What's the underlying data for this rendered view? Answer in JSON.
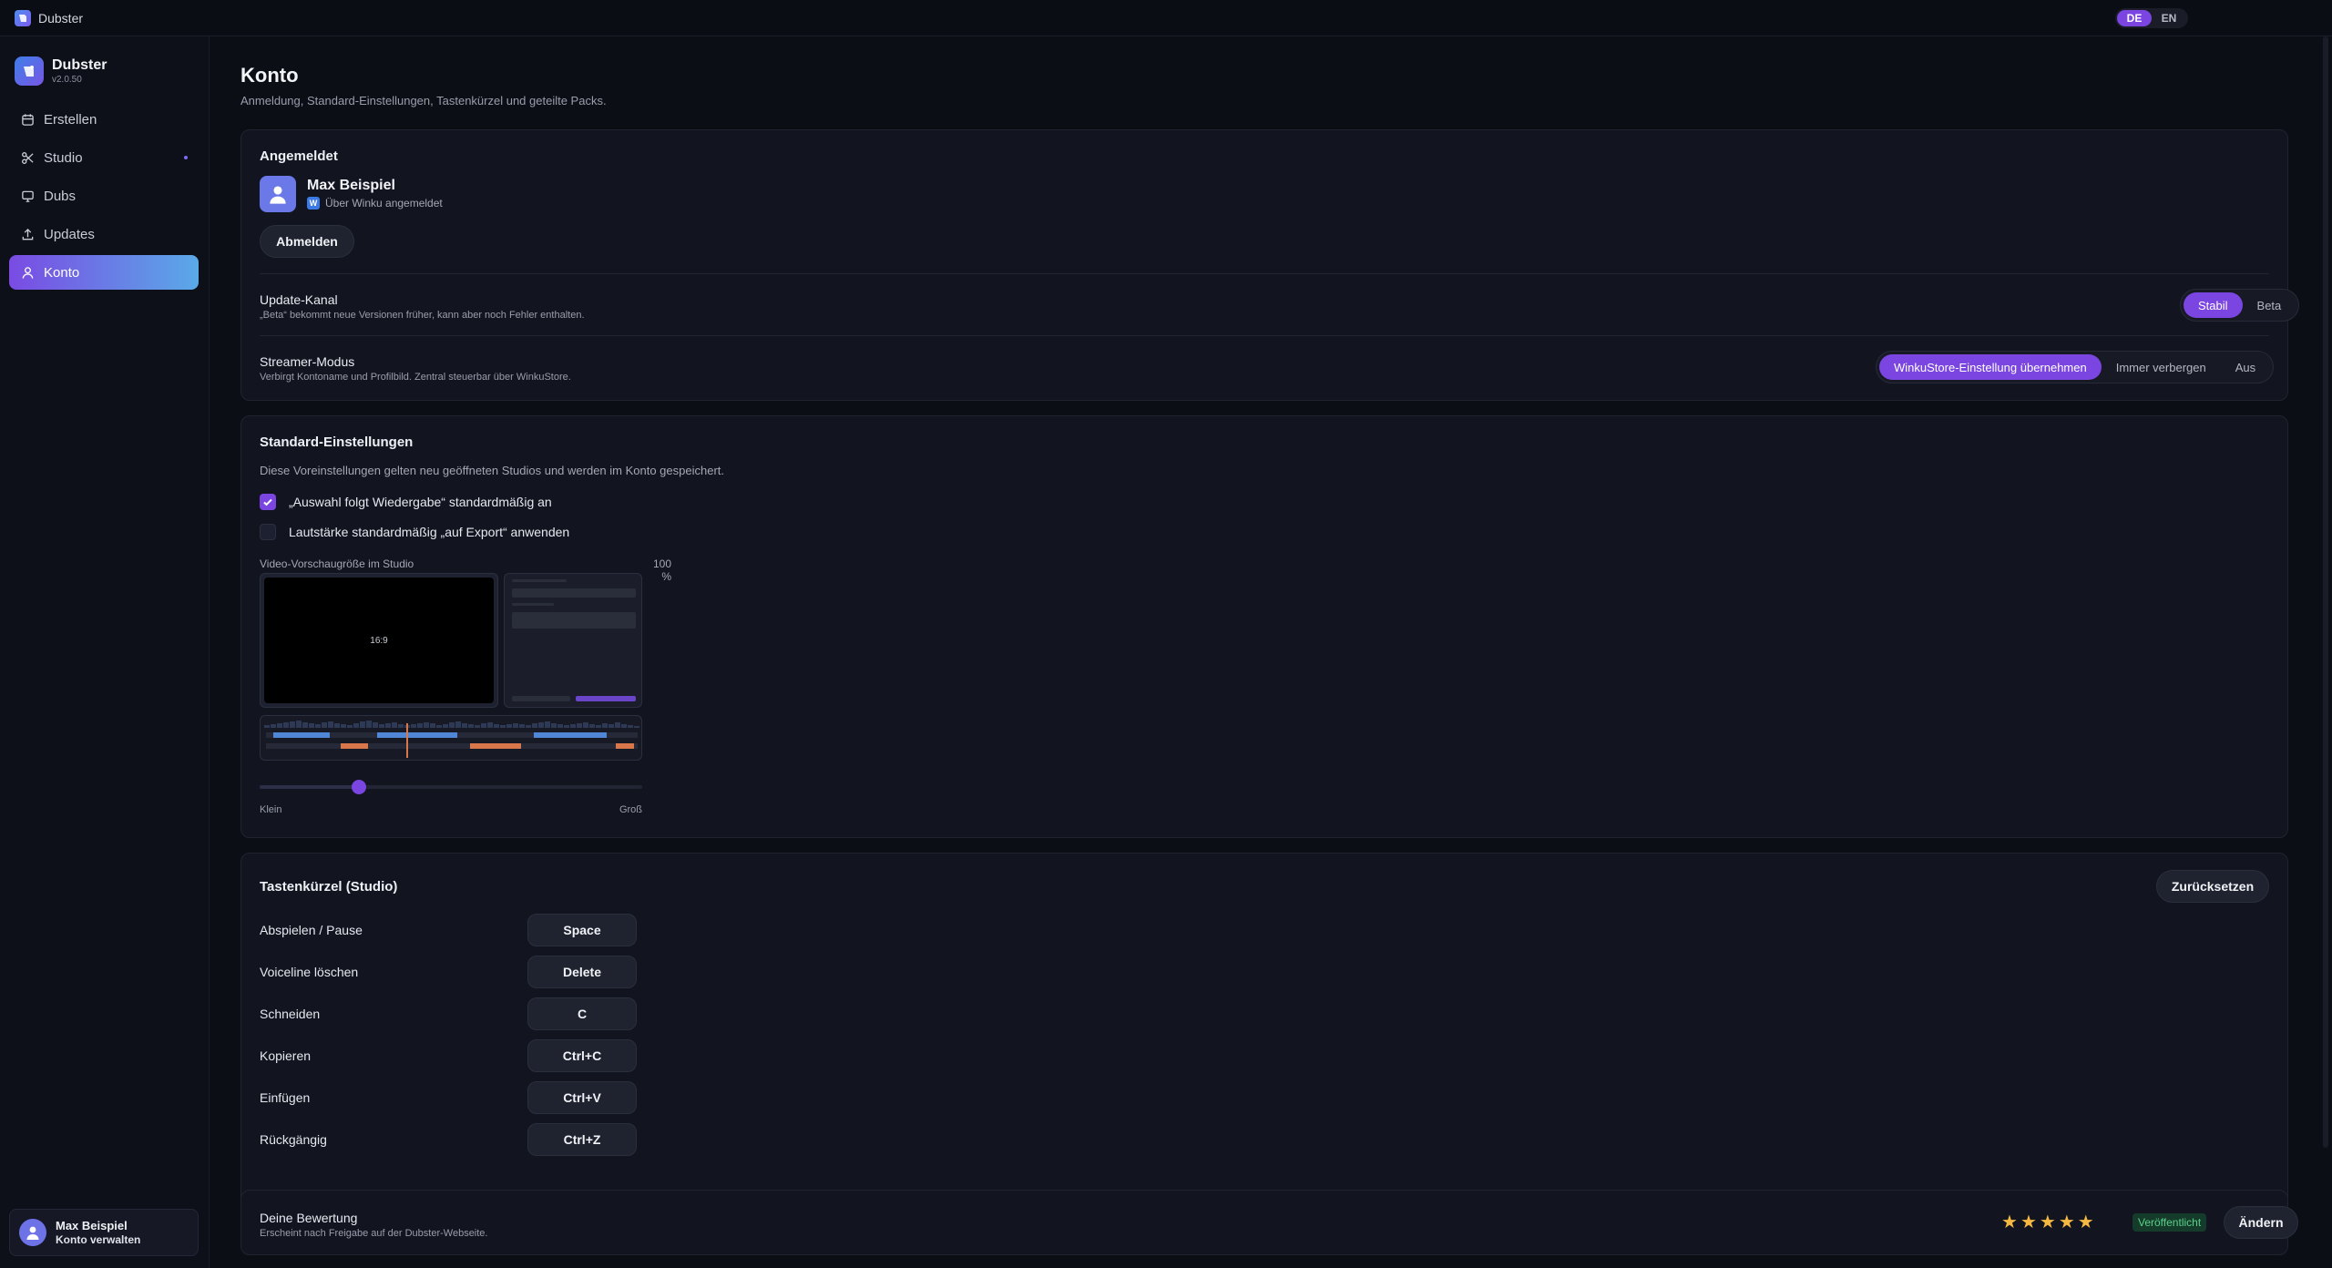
{
  "app": {
    "title": "Dubster"
  },
  "lang": {
    "de": "DE",
    "en": "EN",
    "active": "DE"
  },
  "sidebar": {
    "brand_name": "Dubster",
    "version": "v2.0.50",
    "items": [
      {
        "label": "Erstellen",
        "icon": "calendar-icon"
      },
      {
        "label": "Studio",
        "icon": "scissors-icon"
      },
      {
        "label": "Dubs",
        "icon": "monitor-icon"
      },
      {
        "label": "Updates",
        "icon": "upload-icon"
      },
      {
        "label": "Konto",
        "icon": "user-icon"
      }
    ],
    "user_name": "Max Beispiel",
    "user_sub": "Konto verwalten"
  },
  "page": {
    "title": "Konto",
    "subtitle": "Anmeldung, Standard-Einstellungen, Tastenkürzel und geteilte Packs."
  },
  "account": {
    "title": "Angemeldet",
    "name": "Max Beispiel",
    "via_badge": "W",
    "via": "Über Winku angemeldet",
    "logout": "Abmelden",
    "update_channel_label": "Update-Kanal",
    "update_channel_hint": "„Beta“ bekommt neue Versionen früher, kann aber noch Fehler enthalten.",
    "channel_options": [
      "Stabil",
      "Beta"
    ],
    "channel_selected": "Stabil",
    "streamer_label": "Streamer-Modus",
    "streamer_hint": "Verbirgt Kontoname und Profilbild. Zentral steuerbar über WinkuStore.",
    "streamer_options": [
      "WinkuStore-Einstellung übernehmen",
      "Immer verbergen",
      "Aus"
    ],
    "streamer_selected": "WinkuStore-Einstellung übernehmen"
  },
  "defaults": {
    "title": "Standard-Einstellungen",
    "hint": "Diese Voreinstellungen gelten neu geöffneten Studios und werden im Konto gespeichert.",
    "check1": "„Auswahl folgt Wiedergabe“ standardmäßig an",
    "check1_on": true,
    "check2": "Lautstärke standardmäßig „auf Export“ anwenden",
    "check2_on": false,
    "preview_label": "Video-Vorschaugröße im Studio",
    "preview_pct": "100 %",
    "video_text": "16:9",
    "slider_value": 0.26,
    "slider_min": "Klein",
    "slider_max": "Groß"
  },
  "shortcuts": {
    "title": "Tastenkürzel (Studio)",
    "reset": "Zurücksetzen",
    "items": [
      {
        "label": "Abspielen / Pause",
        "key": "Space"
      },
      {
        "label": "Voiceline löschen",
        "key": "Delete"
      },
      {
        "label": "Schneiden",
        "key": "C"
      },
      {
        "label": "Kopieren",
        "key": "Ctrl+C"
      },
      {
        "label": "Einfügen",
        "key": "Ctrl+V"
      },
      {
        "label": "Rückgängig",
        "key": "Ctrl+Z"
      }
    ]
  },
  "rating": {
    "title": "Deine Bewertung",
    "hint": "Erscheint nach Freigabe auf der Dubster-Webseite.",
    "stars": 5,
    "status": "Veröffentlicht",
    "change": "Ändern"
  },
  "colors": {
    "accent": "#7a45e0",
    "active_gradient_end": "#5aa9e8",
    "star": "#f5b942"
  }
}
